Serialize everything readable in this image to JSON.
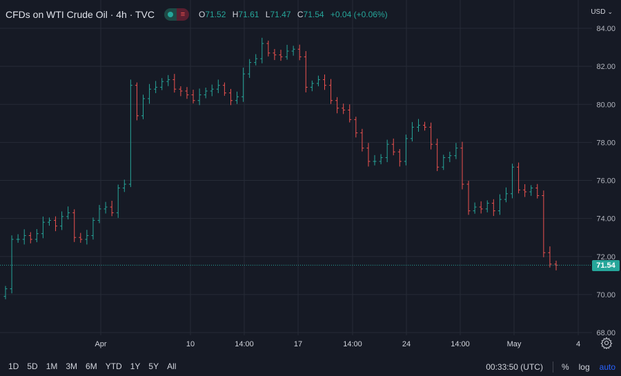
{
  "header": {
    "title": "CFDs on WTI Crude Oil · 4h · TVC",
    "open_label": "O",
    "open": "71.52",
    "high_label": "H",
    "high": "71.61",
    "low_label": "L",
    "low": "71.47",
    "close_label": "C",
    "close": "71.54",
    "change": "+0.04 (+0.06%)",
    "currency": "USD"
  },
  "price_axis": {
    "ticks": [
      "84.00",
      "82.00",
      "80.00",
      "78.00",
      "76.00",
      "74.00",
      "72.00",
      "70.00",
      "68.00"
    ],
    "last_price": "71.54"
  },
  "time_axis": {
    "labels": [
      "Apr",
      "10",
      "14:00",
      "17",
      "14:00",
      "24",
      "14:00",
      "May",
      "4"
    ]
  },
  "toolbar": {
    "ranges": [
      "1D",
      "5D",
      "1M",
      "3M",
      "6M",
      "YTD",
      "1Y",
      "5Y",
      "All"
    ],
    "clock": "00:33:50 (UTC)",
    "percent": "%",
    "log": "log",
    "auto": "auto"
  },
  "colors": {
    "background": "#161a25",
    "up": "#26a69a",
    "down": "#ef5350",
    "grid": "#262b37",
    "accent": "#2962ff"
  },
  "chart_data": {
    "type": "line",
    "title": "CFDs on WTI Crude Oil · 4h · TVC",
    "ylim": [
      68,
      84.4
    ],
    "y_ticks": [
      84,
      82,
      80,
      78,
      76,
      74,
      72,
      70,
      68
    ],
    "x_labels": [
      "Apr",
      "10",
      "14:00",
      "17",
      "14:00",
      "24",
      "14:00",
      "May",
      "4"
    ],
    "last_price": 71.54,
    "series": [
      {
        "values": [
          70.3,
          72.9,
          72.9,
          73.1,
          72.9,
          73.2,
          73.8,
          73.9,
          73.6,
          74.1,
          74.3,
          73.0,
          72.9,
          73.1,
          73.9,
          74.5,
          74.6,
          74.3,
          75.6,
          75.8,
          81.0,
          79.4,
          80.3,
          80.8,
          80.9,
          81.2,
          81.3,
          80.8,
          80.7,
          80.5,
          80.2,
          80.5,
          80.7,
          80.8,
          81.0,
          80.6,
          80.2,
          80.4,
          81.6,
          82.2,
          82.4,
          83.2,
          82.7,
          82.6,
          82.5,
          82.8,
          82.9,
          82.5,
          80.9,
          81.1,
          81.3,
          81.0,
          80.2,
          79.8,
          79.7,
          79.2,
          78.5,
          77.7,
          77.0,
          77.0,
          77.2,
          77.9,
          77.5,
          77.0,
          78.2,
          78.8,
          78.9,
          78.8,
          77.9,
          76.7,
          77.2,
          77.3,
          77.7,
          75.8,
          74.4,
          74.6,
          74.5,
          74.8,
          74.4,
          75.0,
          75.3,
          76.7,
          75.5,
          75.4,
          75.6,
          75.2,
          72.2,
          71.6,
          71.54
        ],
        "day_breaks": [
          20,
          41,
          48
        ]
      }
    ]
  }
}
